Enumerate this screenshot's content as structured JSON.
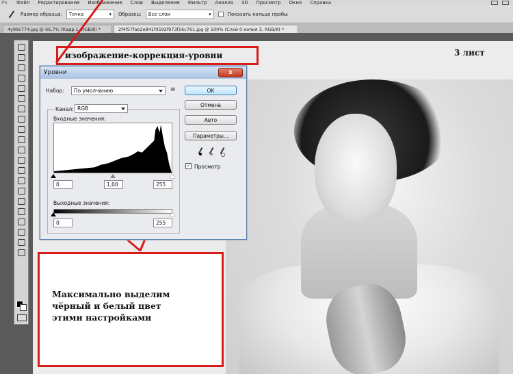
{
  "menubar": {
    "items": [
      "Файл",
      "Редактирование",
      "Изображение",
      "Слои",
      "Выделение",
      "Фильтр",
      "Анализ",
      "3D",
      "Просмотр",
      "Окно",
      "Справка"
    ]
  },
  "options": {
    "sample_size_label": "Размер образца:",
    "sample_size_value": "Точка",
    "sample_label": "Образец:",
    "sample_value": "Все слои",
    "ring_label": "Показать кольцо пробы"
  },
  "tabs": [
    {
      "label": "4y99c774.jpg @ 66,7% (Кадр 1, RGB/8) *"
    },
    {
      "label": "2f4f57fab2e841f0592f973f16c761.jpg @ 100% (Слой 0 копия 3, RGB/8) *"
    }
  ],
  "canvas": {
    "sheet_label": "3 лист",
    "title_annotation": "изображение-коррекция-уровни",
    "note_text": "Максимально выделим\nчёрный и белый цвет\n  этими настройками"
  },
  "dialog": {
    "title": "Уровни",
    "close": "x",
    "preset_label": "Набор:",
    "preset_value": "По умолчанию",
    "channel_label": "Канал:",
    "channel_value": "RGB",
    "input_label": "Входные значения:",
    "input_black": "0",
    "input_gamma": "1,00",
    "input_white": "255",
    "output_label": "Выходные значения:",
    "output_black": "0",
    "output_white": "255",
    "buttons": {
      "ok": "OK",
      "cancel": "Отмена",
      "auto": "Авто",
      "options": "Параметры..."
    },
    "preview_label": "Просмотр",
    "preview_checked": true
  },
  "colors": {
    "annotation_red": "#d71a1a",
    "dialog_border": "#5b7fae",
    "foreground": "#000000",
    "background": "#ffffff"
  }
}
